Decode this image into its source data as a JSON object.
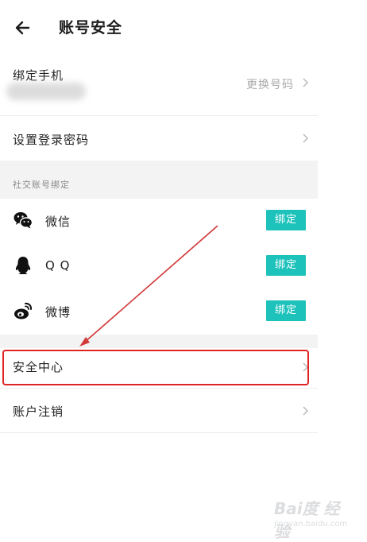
{
  "header": {
    "title": "账号安全",
    "back_icon": "arrow-left-icon"
  },
  "phone": {
    "label": "绑定手机",
    "value": "更换号码"
  },
  "password": {
    "label": "设置登录密码"
  },
  "social": {
    "section_label": "社交账号绑定",
    "items": [
      {
        "label": "微信",
        "icon": "wechat-icon",
        "button": "绑定"
      },
      {
        "label": "Q Q",
        "icon": "qq-icon",
        "button": "绑定"
      },
      {
        "label": "微博",
        "icon": "weibo-icon",
        "button": "绑定"
      }
    ]
  },
  "security_center": {
    "label": "安全中心"
  },
  "account_cancel": {
    "label": "账户注销"
  },
  "watermark": {
    "text": "Bai度 经验",
    "sub": "jingyan.baidu.com"
  },
  "colors": {
    "accent": "#1dc2bb",
    "highlight": "#e02424",
    "section_bg": "#f3f3f4"
  }
}
